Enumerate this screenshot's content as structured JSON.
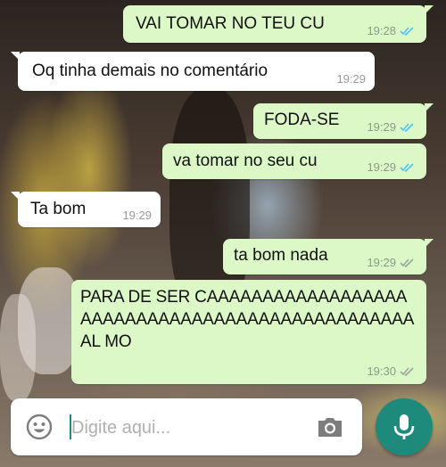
{
  "messages": [
    {
      "text": "VAI TOMAR NO TEU CU",
      "time": "19:28",
      "direction": "out",
      "status": "read"
    },
    {
      "text": "Oq tinha demais no comentário",
      "time": "19:29",
      "direction": "in"
    },
    {
      "text": "FODA-SE",
      "time": "19:29",
      "direction": "out",
      "status": "read"
    },
    {
      "text": "va tomar no seu cu",
      "time": "19:29",
      "direction": "out",
      "status": "read"
    },
    {
      "text": "Ta bom",
      "time": "19:29",
      "direction": "in"
    },
    {
      "text": "ta bom nada",
      "time": "19:29",
      "direction": "out",
      "status": "delivered"
    },
    {
      "text": "PARA DE SER CAAAAAAAAAAAAAAAAAAAAAAAAAAAAAAAAAAAAAAAAAAAAAAAAAL MO",
      "time": "19:30",
      "direction": "out",
      "status": "delivered"
    }
  ],
  "composer": {
    "placeholder": "Digite aqui...",
    "emoji_icon": "emoji-icon",
    "camera_icon": "camera-icon",
    "mic_icon": "microphone-icon"
  },
  "colors": {
    "outgoing_bubble": "#dcf8c6",
    "incoming_bubble": "#ffffff",
    "read_ticks": "#4fc3f7",
    "delivered_ticks": "#9aa79a",
    "accent": "#1d8a7c"
  }
}
